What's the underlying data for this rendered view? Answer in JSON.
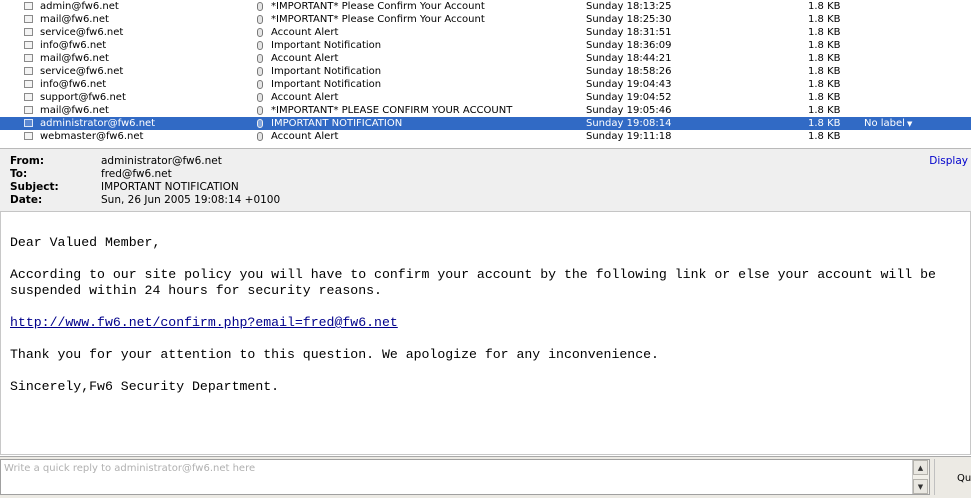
{
  "messages": [
    {
      "sender": "admin@fw6.net",
      "subject": "*IMPORTANT* Please Confirm Your Account",
      "date": "Sunday 18:13:25",
      "size": "1.8 KB",
      "label": "",
      "selected": false
    },
    {
      "sender": "mail@fw6.net",
      "subject": "*IMPORTANT* Please Confirm Your Account",
      "date": "Sunday 18:25:30",
      "size": "1.8 KB",
      "label": "",
      "selected": false
    },
    {
      "sender": "service@fw6.net",
      "subject": "Account Alert",
      "date": "Sunday 18:31:51",
      "size": "1.8 KB",
      "label": "",
      "selected": false
    },
    {
      "sender": "info@fw6.net",
      "subject": "Important Notification",
      "date": "Sunday 18:36:09",
      "size": "1.8 KB",
      "label": "",
      "selected": false
    },
    {
      "sender": "mail@fw6.net",
      "subject": "Account Alert",
      "date": "Sunday 18:44:21",
      "size": "1.8 KB",
      "label": "",
      "selected": false
    },
    {
      "sender": "service@fw6.net",
      "subject": "Important Notification",
      "date": "Sunday 18:58:26",
      "size": "1.8 KB",
      "label": "",
      "selected": false
    },
    {
      "sender": "info@fw6.net",
      "subject": "Important Notification",
      "date": "Sunday 19:04:43",
      "size": "1.8 KB",
      "label": "",
      "selected": false
    },
    {
      "sender": "support@fw6.net",
      "subject": "Account Alert",
      "date": "Sunday 19:04:52",
      "size": "1.8 KB",
      "label": "",
      "selected": false
    },
    {
      "sender": "mail@fw6.net",
      "subject": "*IMPORTANT* PLEASE CONFIRM YOUR ACCOUNT",
      "date": "Sunday 19:05:46",
      "size": "1.8 KB",
      "label": "",
      "selected": false
    },
    {
      "sender": "administrator@fw6.net",
      "subject": "IMPORTANT NOTIFICATION",
      "date": "Sunday 19:08:14",
      "size": "1.8 KB",
      "label": "No label",
      "selected": true
    },
    {
      "sender": "webmaster@fw6.net",
      "subject": "Account Alert",
      "date": "Sunday 19:11:18",
      "size": "1.8 KB",
      "label": "",
      "selected": false
    }
  ],
  "header": {
    "from_label": "From:",
    "from": "administrator@fw6.net",
    "to_label": "To:",
    "to": "fred@fw6.net",
    "subject_label": "Subject:",
    "subject": "IMPORTANT NOTIFICATION",
    "date_label": "Date:",
    "date": "Sun, 26 Jun 2005 19:08:14 +0100",
    "display_link": "Display"
  },
  "body": {
    "greeting": "Dear Valued Member,",
    "line1": "According to our site policy you will have to confirm your account by the following link or else your account will be",
    "line2": "suspended within 24 hours for security reasons.",
    "link": "http://www.fw6.net/confirm.php?email=fred@fw6.net",
    "thanks": "Thank you for your attention to this question. We apologize for any inconvenience.",
    "signoff": "Sincerely,Fw6 Security Department."
  },
  "reply": {
    "placeholder": "Write a quick reply to administrator@fw6.net here",
    "button_label": "Qu"
  },
  "icons": {
    "message": "envelope-icon",
    "attachment": "attachment-icon",
    "label_dropdown": "chevron-down-icon",
    "scroll_up": "scroll-up-icon",
    "scroll_down": "scroll-down-icon"
  },
  "colors": {
    "selection": "#316ac5",
    "header_bg": "#efefef",
    "link": "#00008b"
  }
}
